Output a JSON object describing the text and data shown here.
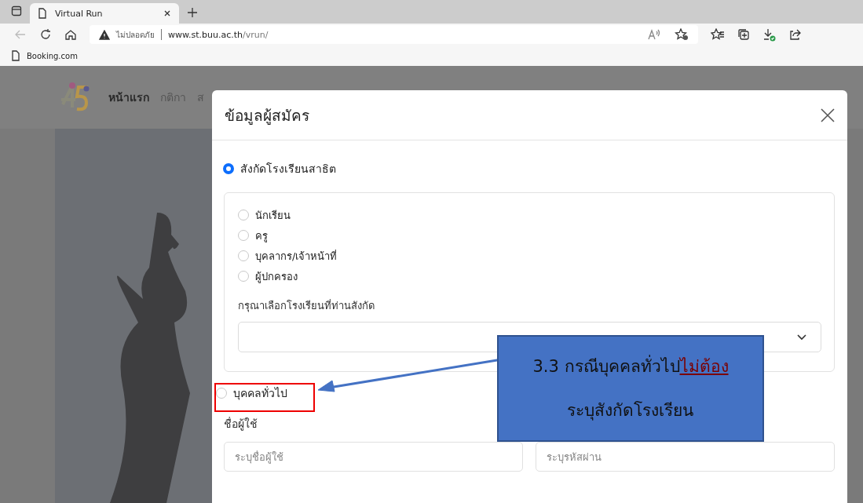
{
  "browser": {
    "tab_title": "Virtual Run",
    "url_warning": "ไม่ปลอดภัย",
    "url_host": "www.st.buu.ac.th",
    "url_path": "/vrun/",
    "bookmark": "Booking.com"
  },
  "site": {
    "nav": [
      {
        "label": "หน้าแรก",
        "selected": true
      },
      {
        "label": "กติกา",
        "selected": false
      },
      {
        "label": "ส",
        "selected": false
      }
    ]
  },
  "modal": {
    "title": "ข้อมูลผู้สมัคร",
    "affiliation": {
      "label": "สังกัดโรงเรียนสาธิต",
      "selected": true
    },
    "roles": [
      {
        "label": "นักเรียน",
        "selected": false
      },
      {
        "label": "ครู",
        "selected": false
      },
      {
        "label": "บุคลากร/เจ้าหน้าที่",
        "selected": false
      },
      {
        "label": "ผู้ปกครอง",
        "selected": false
      }
    ],
    "school_label": "กรุณาเลือกโรงเรียนที่ท่านสังกัด",
    "general": {
      "label": "บุคคลทั่วไป",
      "selected": false
    },
    "username_label": "ชื่อผู้ใช้",
    "fields": [
      {
        "placeholder": "ระบุชื่อผู้ใช้"
      },
      {
        "placeholder": "ระบุรหัสผ่าน"
      }
    ]
  },
  "callout": {
    "text": "3.3 กรณีบุคคลทั่วไป",
    "emphasis": "ไม่ต้อง",
    "text_2": "ระบุสังกัดโรงเรียน"
  }
}
